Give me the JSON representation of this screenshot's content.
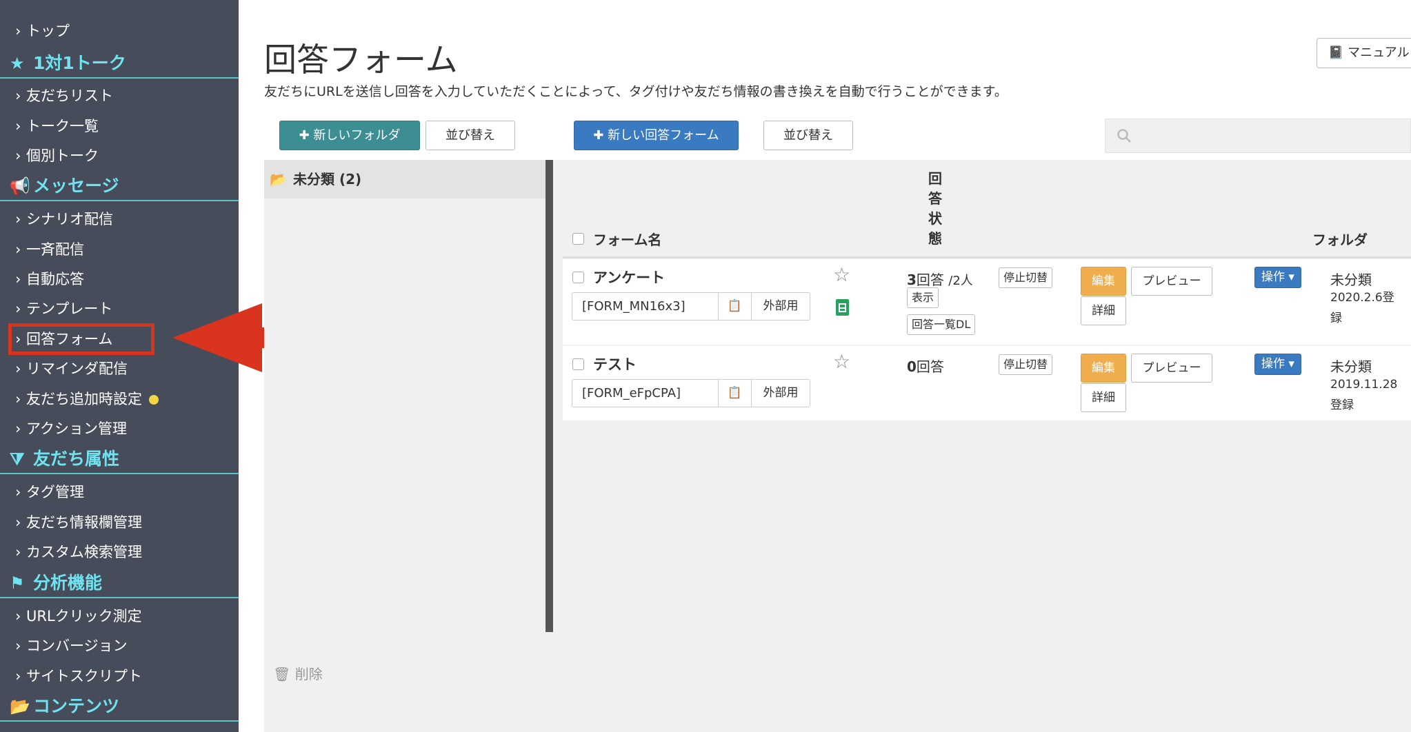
{
  "sidebar": {
    "top": "トップ",
    "section_talk": "1対1トーク",
    "friend_list": "友だちリスト",
    "talk_list": "トーク一覧",
    "individual_talk": "個別トーク",
    "section_message": "メッセージ",
    "scenario": "シナリオ配信",
    "broadcast": "一斉配信",
    "auto_reply": "自動応答",
    "template": "テンプレート",
    "answer_form": "回答フォーム",
    "reminder": "リマインダ配信",
    "friend_add_settings": "友だち追加時設定",
    "action_mgmt": "アクション管理",
    "section_attr": "友だち属性",
    "tag_mgmt": "タグ管理",
    "friend_info_mgmt": "友だち情報欄管理",
    "custom_search": "カスタム検索管理",
    "section_analysis": "分析機能",
    "url_click": "URLクリック測定",
    "conversion": "コンバージョン",
    "site_script": "サイトスクリプト",
    "section_contents": "コンテンツ"
  },
  "page": {
    "title": "回答フォーム",
    "description": "友だちにURLを送信し回答を入力していただくことによって、タグ付けや友だち情報の書き換えを自動で行うことができます。",
    "manual": "マニュアル"
  },
  "toolbar": {
    "new_folder": "新しいフォルダ",
    "sort1": "並び替え",
    "new_form": "新しい回答フォーム",
    "sort2": "並び替え",
    "search_placeholder": ""
  },
  "folders": [
    {
      "label": "未分類 (2)"
    }
  ],
  "delete_label": "削除",
  "table": {
    "col_name": "フォーム名",
    "col_status_chars": [
      "回",
      "答",
      "状",
      "態"
    ],
    "col_folder": "フォルダ"
  },
  "rows": [
    {
      "name": "アンケート",
      "code": "[FORM_MN16x3]",
      "external": "外部用",
      "count": "3",
      "count_unit": "回答",
      "people": "/2人",
      "show": "表示",
      "list_dl": "回答一覧DL",
      "toggle": "停止切替",
      "edit": "編集",
      "preview": "プレビュー",
      "detail": "詳細",
      "operate": "操作",
      "folder": "未分類",
      "date": "2020.2.6登録"
    },
    {
      "name": "テスト",
      "code": "[FORM_eFpCPA]",
      "external": "外部用",
      "count": "0",
      "count_unit": "回答",
      "toggle": "停止切替",
      "edit": "編集",
      "preview": "プレビュー",
      "detail": "詳細",
      "operate": "操作",
      "folder": "未分類",
      "date": "2019.11.28登録"
    }
  ]
}
